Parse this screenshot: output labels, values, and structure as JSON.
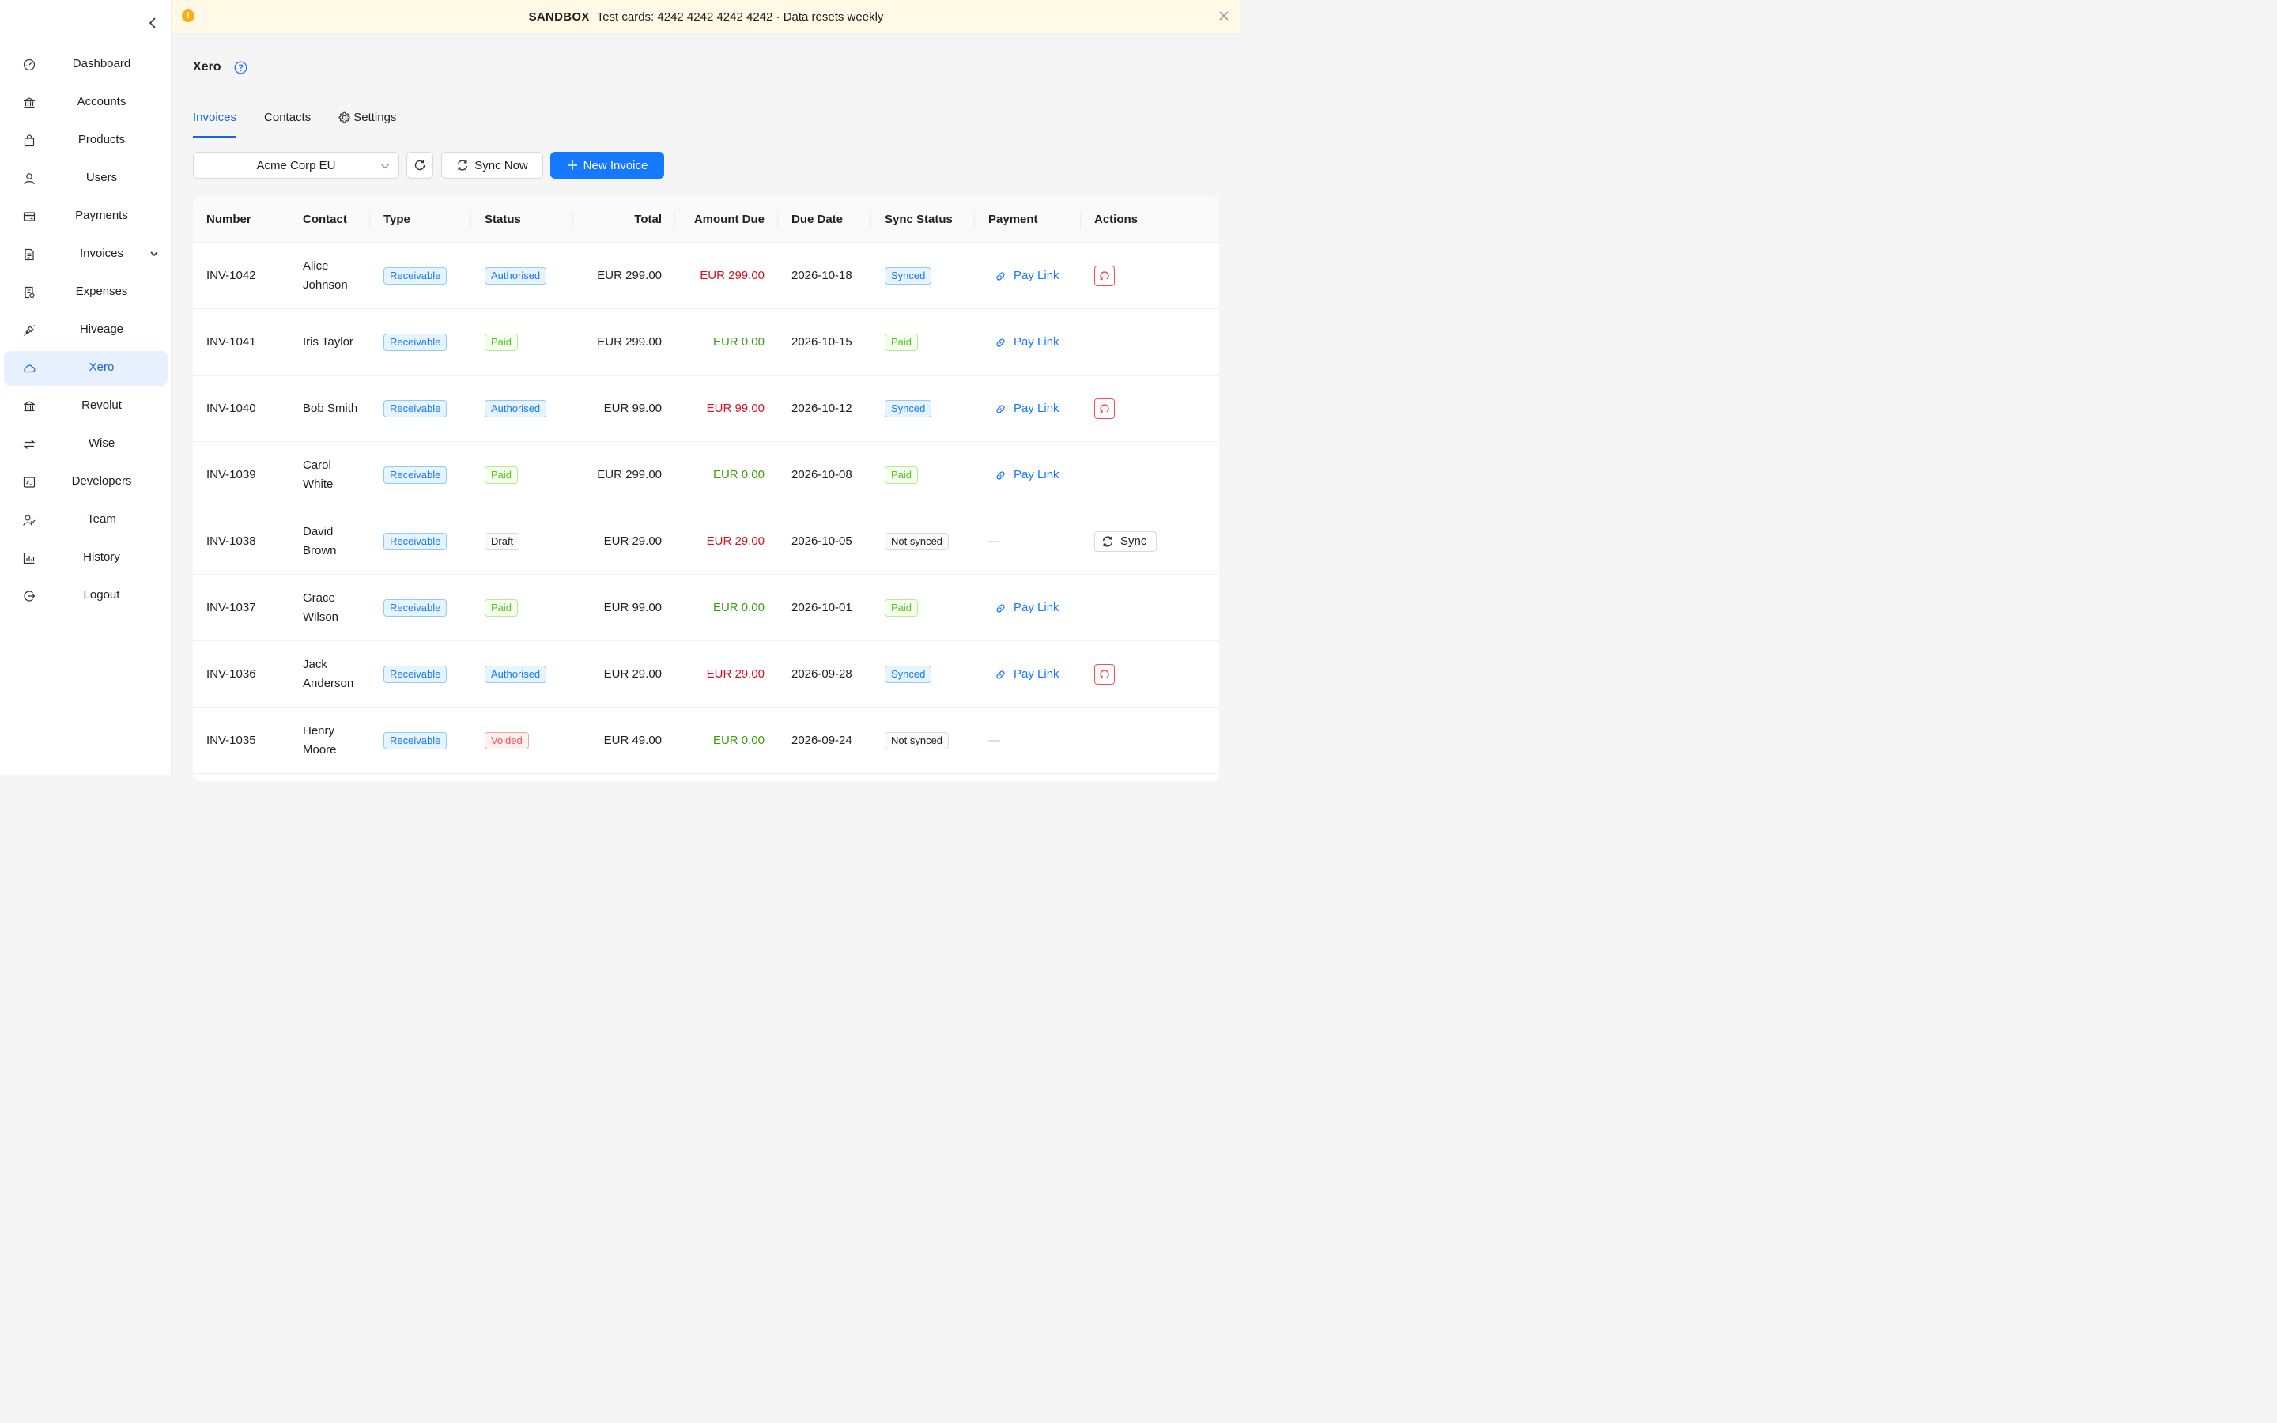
{
  "banner": {
    "tag": "SANDBOX",
    "message": "Test cards: 4242 4242 4242 4242 · Data resets weekly"
  },
  "sidebar": {
    "items": [
      {
        "label": "Dashboard",
        "icon": "dashboard-icon"
      },
      {
        "label": "Accounts",
        "icon": "bank-icon"
      },
      {
        "label": "Products",
        "icon": "shopping-bag-icon"
      },
      {
        "label": "Users",
        "icon": "user-icon"
      },
      {
        "label": "Payments",
        "icon": "credit-card-icon"
      },
      {
        "label": "Invoices",
        "icon": "file-icon",
        "expandable": true
      },
      {
        "label": "Expenses",
        "icon": "receipt-icon"
      },
      {
        "label": "Hiveage",
        "icon": "api-icon"
      },
      {
        "label": "Xero",
        "icon": "cloud-icon",
        "active": true
      },
      {
        "label": "Revolut",
        "icon": "bank-icon"
      },
      {
        "label": "Wise",
        "icon": "swap-icon"
      },
      {
        "label": "Developers",
        "icon": "terminal-icon"
      },
      {
        "label": "Team",
        "icon": "team-icon"
      },
      {
        "label": "History",
        "icon": "bar-chart-icon"
      },
      {
        "label": "Logout",
        "icon": "logout-icon"
      }
    ]
  },
  "page": {
    "title": "Xero",
    "tabs": [
      {
        "label": "Invoices",
        "active": true
      },
      {
        "label": "Contacts"
      },
      {
        "label": "Settings",
        "icon": "gear-icon"
      }
    ]
  },
  "toolbar": {
    "org_select": "Acme Corp EU",
    "sync_label": "Sync Now",
    "new_invoice_label": "New Invoice"
  },
  "table": {
    "columns": [
      "Number",
      "Contact",
      "Type",
      "Status",
      "Total",
      "Amount Due",
      "Due Date",
      "Sync Status",
      "Payment",
      "Actions"
    ],
    "rows": [
      {
        "number": "INV-1042",
        "contact": "Alice Johnson",
        "type": "Receivable",
        "status": "Authorised",
        "total": "EUR 299.00",
        "due": "EUR 299.00",
        "due_color": "red",
        "date": "2026-10-18",
        "sync": "Synced",
        "payment": "Pay Link",
        "action": "danger"
      },
      {
        "number": "INV-1041",
        "contact": "Iris Taylor",
        "type": "Receivable",
        "status": "Paid",
        "total": "EUR 299.00",
        "due": "EUR 0.00",
        "due_color": "green",
        "date": "2026-10-15",
        "sync": "Paid",
        "payment": "Pay Link",
        "action": ""
      },
      {
        "number": "INV-1040",
        "contact": "Bob Smith",
        "type": "Receivable",
        "status": "Authorised",
        "total": "EUR 99.00",
        "due": "EUR 99.00",
        "due_color": "red",
        "date": "2026-10-12",
        "sync": "Synced",
        "payment": "Pay Link",
        "action": "danger"
      },
      {
        "number": "INV-1039",
        "contact": "Carol White",
        "type": "Receivable",
        "status": "Paid",
        "total": "EUR 299.00",
        "due": "EUR 0.00",
        "due_color": "green",
        "date": "2026-10-08",
        "sync": "Paid",
        "payment": "Pay Link",
        "action": ""
      },
      {
        "number": "INV-1038",
        "contact": "David Brown",
        "type": "Receivable",
        "status": "Draft",
        "total": "EUR 29.00",
        "due": "EUR 29.00",
        "due_color": "red",
        "date": "2026-10-05",
        "sync": "Not synced",
        "payment": "—",
        "action": "sync",
        "action_label": "Sync"
      },
      {
        "number": "INV-1037",
        "contact": "Grace Wilson",
        "type": "Receivable",
        "status": "Paid",
        "total": "EUR 99.00",
        "due": "EUR 0.00",
        "due_color": "green",
        "date": "2026-10-01",
        "sync": "Paid",
        "payment": "Pay Link",
        "action": ""
      },
      {
        "number": "INV-1036",
        "contact": "Jack Anderson",
        "type": "Receivable",
        "status": "Authorised",
        "total": "EUR 29.00",
        "due": "EUR 29.00",
        "due_color": "red",
        "date": "2026-09-28",
        "sync": "Synced",
        "payment": "Pay Link",
        "action": "danger"
      },
      {
        "number": "INV-1035",
        "contact": "Henry Moore",
        "type": "Receivable",
        "status": "Voided",
        "total": "EUR 49.00",
        "due": "EUR 0.00",
        "due_color": "green",
        "date": "2026-09-24",
        "sync": "Not synced",
        "payment": "—",
        "action": ""
      }
    ]
  },
  "colors": {
    "primary": "#1677ff",
    "active_bg": "#e6f0ff",
    "banner_bg": "#fff9e6",
    "warning": "#faad14",
    "danger": "#cf1322",
    "success": "#389e0d"
  }
}
